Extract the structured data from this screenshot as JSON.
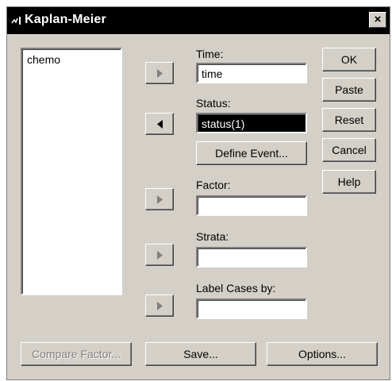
{
  "window": {
    "title": "Kaplan-Meier",
    "close_glyph": "×",
    "icon": "spss-app-icon"
  },
  "variables": [
    "chemo"
  ],
  "fields": {
    "time": {
      "label": "Time:",
      "value": "time"
    },
    "status": {
      "label": "Status:",
      "value": "status(1)"
    },
    "factor": {
      "label": "Factor:",
      "value": ""
    },
    "strata": {
      "label": "Strata:",
      "value": ""
    },
    "label_cases": {
      "label": "Label Cases by:",
      "value": ""
    }
  },
  "buttons": {
    "define_event": "Define Event...",
    "ok": "OK",
    "paste": "Paste",
    "reset": "Reset",
    "cancel": "Cancel",
    "help": "Help",
    "compare_factor": "Compare Factor...",
    "save": "Save...",
    "options": "Options..."
  },
  "colors": {
    "dialog_bg": "#d4d0c8",
    "titlebar_bg": "#000000",
    "selection_bg": "#000000",
    "disabled_text": "#808080"
  }
}
